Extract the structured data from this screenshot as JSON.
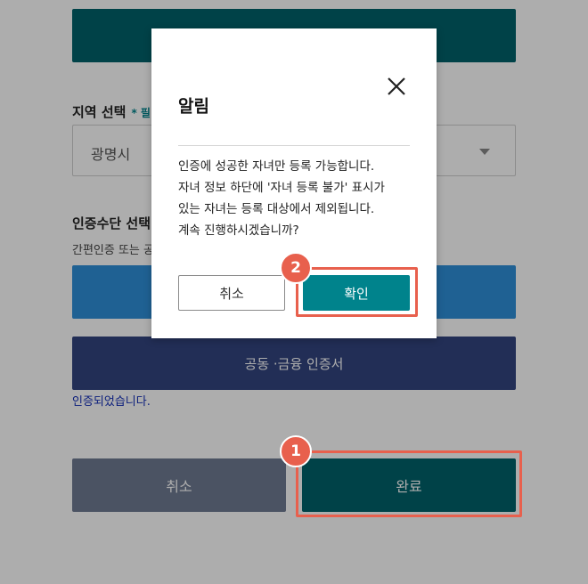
{
  "form": {
    "region_label": "지역 선택",
    "required_mark": "* 필",
    "region_value": "광명시",
    "auth_label": "인증수단 선택",
    "auth_hint": "간편인증 또는 공",
    "auth_cert_label": "공동 ·금융 인증서",
    "auth_done": "인증되었습니다.",
    "cancel_label": "취소",
    "complete_label": "완료"
  },
  "steps": {
    "step1": "1",
    "step2": "2"
  },
  "modal": {
    "title": "알림",
    "message_lines": [
      "인증에 성공한 자녀만 등록 가능합니다.",
      "자녀 정보 하단에 '자녀 등록 불가' 표시가",
      "있는 자녀는 등록 대상에서 제외됩니다.",
      "계속 진행하시겠습니까?"
    ],
    "cancel_label": "취소",
    "confirm_label": "확인",
    "close_icon": "close-icon"
  },
  "colors": {
    "primary_teal": "#00626a",
    "accent_teal": "#00838c",
    "simple_auth_blue": "#2e8fd9",
    "cert_navy": "#33457f",
    "cancel_gray": "#6f7b93",
    "highlight": "#e8604d"
  }
}
